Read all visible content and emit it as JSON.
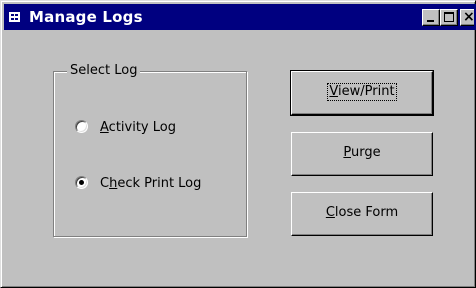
{
  "window": {
    "title": "Manage Logs",
    "controls": {
      "minimize": "_",
      "maximize": "□",
      "close": "×"
    }
  },
  "select_log": {
    "group_label": "Select Log",
    "options": [
      {
        "label_prefix": "",
        "label_access": "A",
        "label_rest": "ctivity Log",
        "checked": false
      },
      {
        "label_prefix": "C",
        "label_access": "h",
        "label_rest": "eck Print Log",
        "checked": true
      }
    ]
  },
  "buttons": {
    "view_print": {
      "label_access": "V",
      "label_rest": "iew/Print"
    },
    "purge": {
      "label_access": "P",
      "label_rest": "urge"
    },
    "close_form": {
      "label_access": "C",
      "label_rest": "lose Form"
    }
  }
}
